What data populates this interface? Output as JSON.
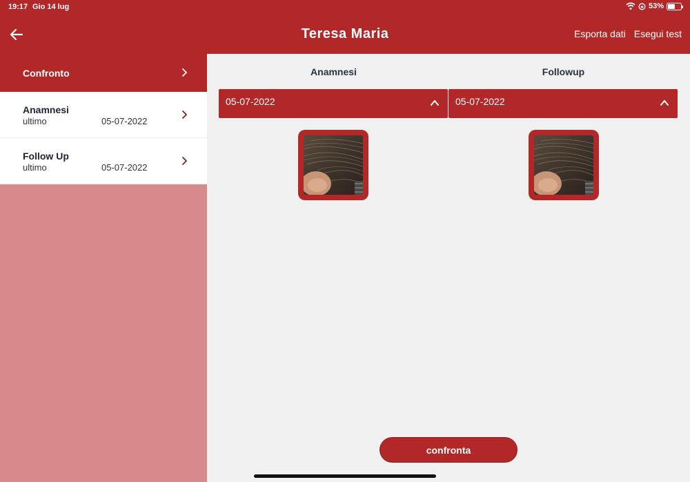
{
  "status_bar": {
    "time": "19:17",
    "date": "Gio 14 lug",
    "battery": "53%",
    "battery_level": 0.53
  },
  "header": {
    "title": "Teresa Maria",
    "actions": [
      "Esporta dati",
      "Esegui test"
    ]
  },
  "sidebar": {
    "items": [
      {
        "label": "Confronto",
        "active": true
      },
      {
        "label": "Anamnesi",
        "sub": "ultimo",
        "date": "05-07-2022"
      },
      {
        "label": "Follow Up",
        "sub": "ultimo",
        "date": "05-07-2022"
      }
    ]
  },
  "main": {
    "columns": [
      {
        "title": "Anamnesi",
        "selected_date": "05-07-2022"
      },
      {
        "title": "Followup",
        "selected_date": "05-07-2022"
      }
    ],
    "compare_button": "confronta"
  },
  "colors": {
    "primary": "#b22828",
    "sidebar_bg": "#d68a8c",
    "main_bg": "#f0f0f0"
  }
}
